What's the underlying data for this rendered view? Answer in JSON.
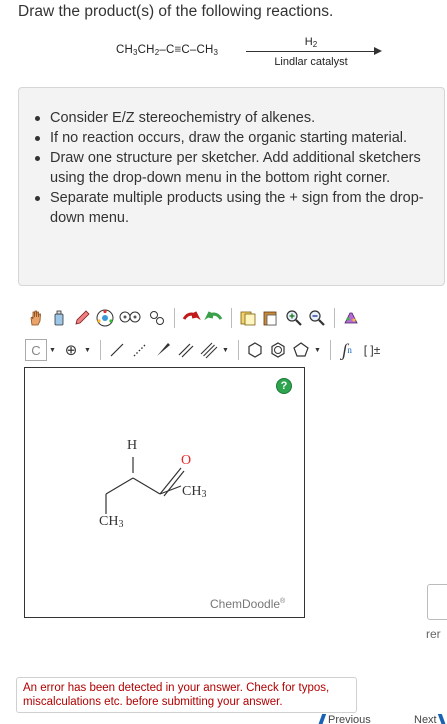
{
  "question": {
    "prompt": "Draw the product(s) of the following reactions."
  },
  "reaction": {
    "reactant_parts": [
      "CH",
      "3",
      "CH",
      "2",
      "–C≡C–CH",
      "3"
    ],
    "reagent_top_parts": [
      "H",
      "2"
    ],
    "reagent_bottom": "Lindlar catalyst"
  },
  "instructions": {
    "items": [
      "Consider E/Z stereochemistry of alkenes.",
      "If no reaction occurs, draw the organic starting material.",
      "Draw one structure per sketcher. Add additional sketchers using the drop-down menu in the bottom right corner.",
      "Separate multiple products using the + sign from the drop-down menu."
    ]
  },
  "toolbar": {
    "row1": [
      "hand-icon",
      "eraser-icon",
      "pencil-icon",
      "ring-template-icon",
      "stereo-icon",
      "rotate-icon",
      "undo-icon",
      "redo-icon",
      "copy-icon",
      "paste-icon",
      "zoom-in-icon",
      "zoom-out-icon",
      "clean-icon"
    ],
    "row2": {
      "carbon_label": "C",
      "charge_label": "⊕",
      "bracket_label": "[ ]±",
      "subscript_label": "n"
    }
  },
  "sketcher": {
    "help_label": "?",
    "brand_label": "ChemDoodle",
    "brand_mark": "®",
    "atom_h": "H",
    "atom_o": "O",
    "group_ch3_right": "CH",
    "group_ch3_right_sub": "3",
    "group_ch3_bottom": "CH",
    "group_ch3_bottom_sub": "3"
  },
  "side": {
    "label": "rer"
  },
  "feedback": {
    "error_text": "An error has been detected in your answer. Check for typos, miscalculations etc. before submitting your answer."
  },
  "nav": {
    "previous_label": "Previous",
    "next_label": "Next"
  },
  "colors": {
    "accent": "#1a62b5",
    "error": "#b00000",
    "help_green": "#2ea44f",
    "oxygen_red": "#e8262a"
  }
}
